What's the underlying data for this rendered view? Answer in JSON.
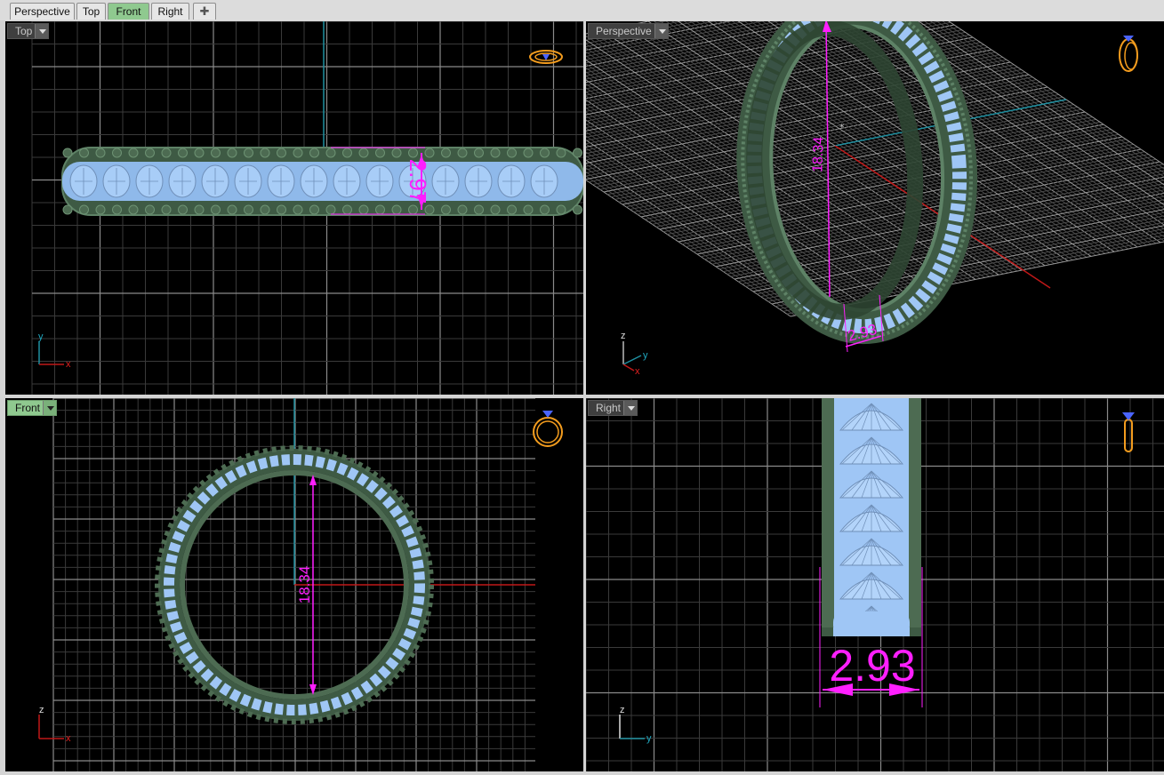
{
  "tabs": [
    {
      "label": "Perspective",
      "active": false
    },
    {
      "label": "Top",
      "active": false
    },
    {
      "label": "Front",
      "active": true
    },
    {
      "label": "Right",
      "active": false
    }
  ],
  "add_tab_icon": "plus-icon",
  "viewports": {
    "top": {
      "label": "Top",
      "dimension": "2.97",
      "axis_labels": {
        "horizontal": "x",
        "vertical": "y"
      }
    },
    "perspective": {
      "label": "Perspective",
      "dimension_height": "18.34",
      "dimension_width": "2.93",
      "axis_labels": {
        "z": "z",
        "y": "y",
        "x": "x"
      }
    },
    "front": {
      "label": "Front",
      "dimension": "18.34",
      "axis_labels": {
        "horizontal": "x",
        "vertical": "z"
      }
    },
    "right": {
      "label": "Right",
      "dimension": "2.93",
      "axis_labels": {
        "horizontal": "y",
        "vertical": "z"
      }
    }
  },
  "colors": {
    "background": "#000000",
    "grid_minor": "#3a3a3a",
    "grid_major": "#8a8a8a",
    "ring_band": "#4d6b52",
    "ring_stones": "#9fc6f5",
    "dimension": "#ff1fff",
    "axis_x": "#c01818",
    "axis_y": "#1f8fa0",
    "active_tab": "#8fc98f",
    "orientation_icon": "#f39c1e"
  }
}
